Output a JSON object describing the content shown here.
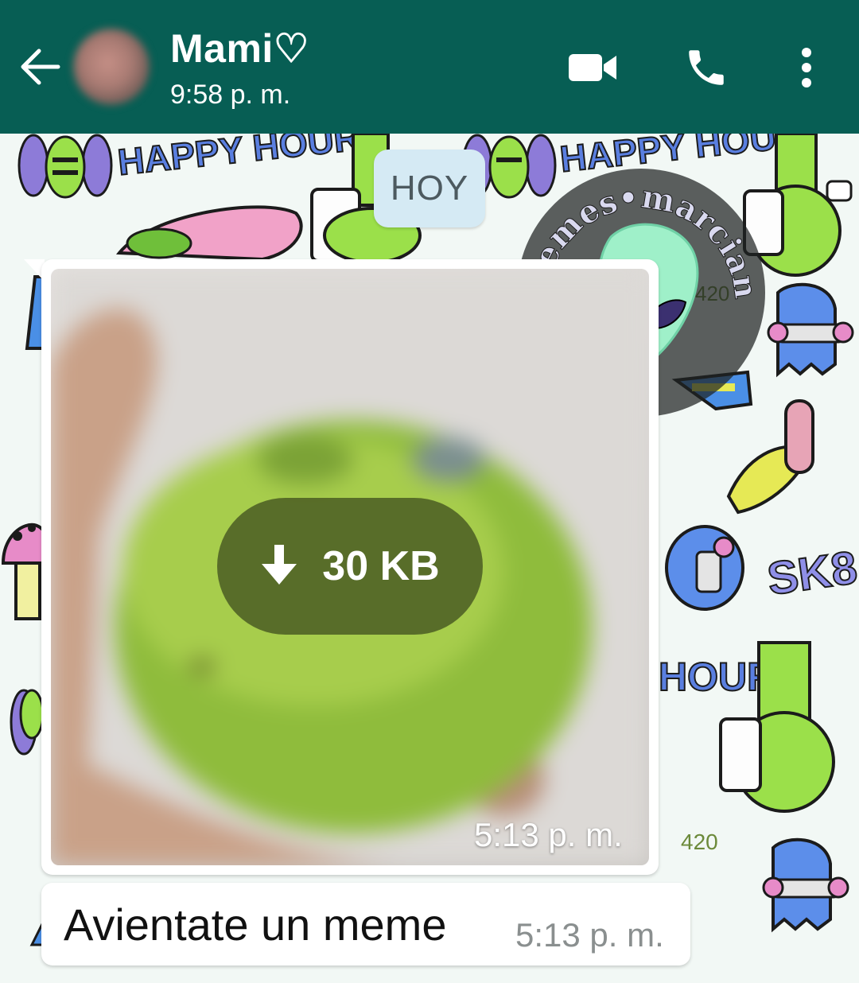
{
  "header": {
    "contact_name": "Mami♡",
    "last_seen": "9:58 p. m.",
    "icons": {
      "back": "arrow-left-icon",
      "video": "video-camera-icon",
      "call": "phone-icon",
      "menu": "more-vertical-icon"
    },
    "color": "#075e54"
  },
  "chat": {
    "day_label": "HOY",
    "wallpaper_text": [
      "HAPPY HOUR",
      "HAPPY HOUR",
      "HOUR",
      "SK8",
      "420",
      "420"
    ],
    "logo_text": "memes•marcianos",
    "messages": [
      {
        "type": "image",
        "download_size": "30 KB",
        "time": "5:13 p. m."
      },
      {
        "type": "text",
        "text": "Avientate un meme",
        "time": "5:13 p. m."
      }
    ]
  }
}
